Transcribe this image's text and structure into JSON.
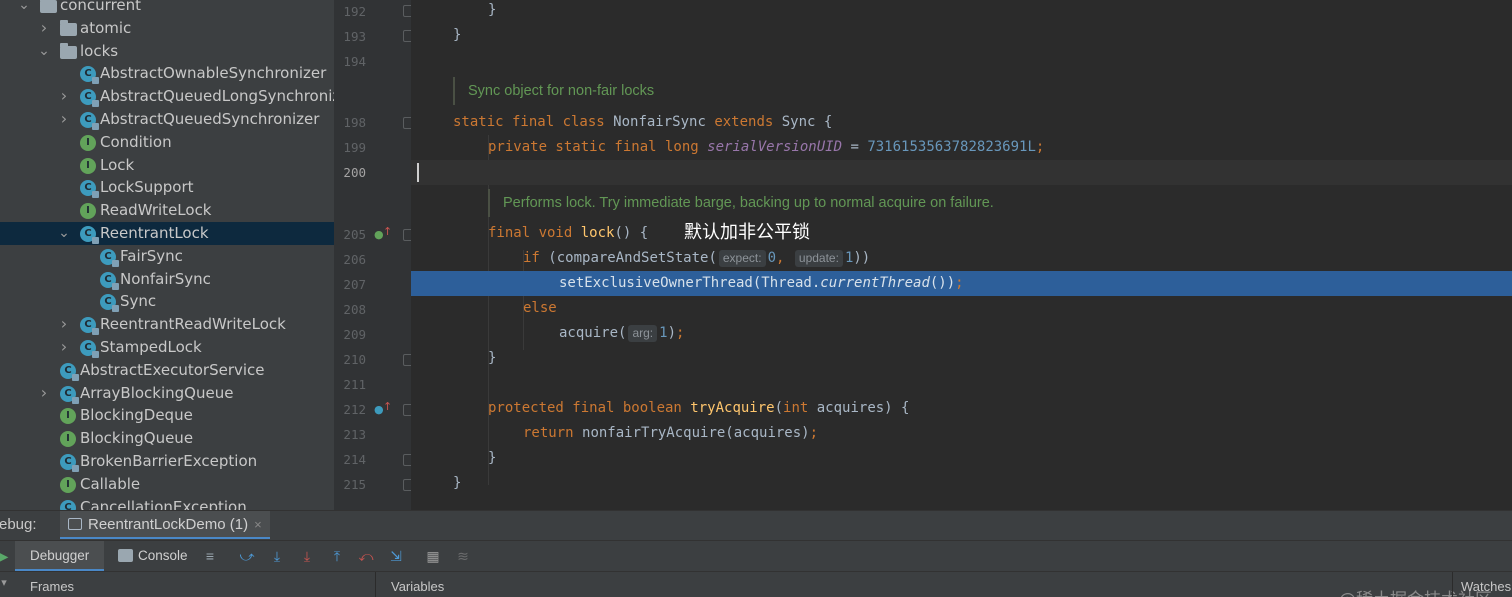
{
  "project_tree": {
    "items": [
      {
        "label": "concurrent",
        "kind": "package",
        "expand": "expanded"
      },
      {
        "label": "atomic",
        "kind": "package",
        "expand": "collapsed"
      },
      {
        "label": "locks",
        "kind": "package",
        "expand": "expanded"
      },
      {
        "label": "AbstractOwnableSynchronizer",
        "kind": "class",
        "expand": "none"
      },
      {
        "label": "AbstractQueuedLongSynchronizer",
        "kind": "class",
        "expand": "collapsed"
      },
      {
        "label": "AbstractQueuedSynchronizer",
        "kind": "class",
        "expand": "collapsed"
      },
      {
        "label": "Condition",
        "kind": "interface",
        "expand": "none"
      },
      {
        "label": "Lock",
        "kind": "interface",
        "expand": "none"
      },
      {
        "label": "LockSupport",
        "kind": "class",
        "expand": "none"
      },
      {
        "label": "ReadWriteLock",
        "kind": "interface",
        "expand": "none"
      },
      {
        "label": "ReentrantLock",
        "kind": "class",
        "expand": "expanded",
        "selected": true
      },
      {
        "label": "FairSync",
        "kind": "class",
        "expand": "none"
      },
      {
        "label": "NonfairSync",
        "kind": "class",
        "expand": "none"
      },
      {
        "label": "Sync",
        "kind": "class",
        "expand": "none"
      },
      {
        "label": "ReentrantReadWriteLock",
        "kind": "class",
        "expand": "collapsed"
      },
      {
        "label": "StampedLock",
        "kind": "class",
        "expand": "collapsed"
      },
      {
        "label": "AbstractExecutorService",
        "kind": "class",
        "expand": "none"
      },
      {
        "label": "ArrayBlockingQueue",
        "kind": "class",
        "expand": "collapsed"
      },
      {
        "label": "BlockingDeque",
        "kind": "interface",
        "expand": "none"
      },
      {
        "label": "BlockingQueue",
        "kind": "interface",
        "expand": "none"
      },
      {
        "label": "BrokenBarrierException",
        "kind": "class",
        "expand": "none"
      },
      {
        "label": "Callable",
        "kind": "interface",
        "expand": "none"
      },
      {
        "label": "CancellationException",
        "kind": "class",
        "expand": "none"
      }
    ]
  },
  "gutter": {
    "line_numbers": [
      "192",
      "193",
      "194",
      "198",
      "199",
      "200",
      "205",
      "206",
      "207",
      "208",
      "209",
      "210",
      "211",
      "212",
      "213",
      "214",
      "215"
    ]
  },
  "editor": {
    "doc_comment_1": "Sync object for non-fair locks",
    "doc_comment_2": "Performs lock. Try immediate barge, backing up to normal acquire on failure.",
    "code": {
      "l192": "}",
      "l193": "}",
      "l198_kw": "static final class ",
      "l198_name": "NonfairSync ",
      "l198_ext": "extends ",
      "l198_rest": "Sync {",
      "l199_kw": "private static final long ",
      "l199_field": "serialVersionUID",
      "l199_eq": " = ",
      "l199_num": "7316153563782823691L",
      "l199_semi": ";",
      "l205_kw": "final void ",
      "l205_fn": "lock",
      "l205_rest": "() {",
      "l206_kw": "if ",
      "l206_a": "(compareAndSetState(",
      "l206_hint1": "expect:",
      "l206_n1": "0",
      "l206_comma": ",",
      "l206_hint2": "update:",
      "l206_n2": "1",
      "l206_end": "))",
      "l207_a": "setExclusiveOwnerThread(Thread.",
      "l207_b": "currentThread",
      "l207_c": "())",
      "l207_semi": ";",
      "l208": "else",
      "l209_a": "acquire(",
      "l209_hint": "arg:",
      "l209_n": "1",
      "l209_end": ")",
      "l209_semi": ";",
      "l210": "}",
      "l212_kw": "protected final boolean ",
      "l212_fn": "tryAcquire",
      "l212_p": "(",
      "l212_int": "int ",
      "l212_rest": "acquires) {",
      "l213_kw": "return ",
      "l213_rest": "nonfairTryAcquire(acquires)",
      "l213_semi": ";",
      "l214": "}",
      "l215": "}"
    },
    "overlay_annotation": "默认加非公平锁"
  },
  "debug_panel": {
    "title": "ebug:",
    "session_tab": "ReentrantLockDemo (1)",
    "close_glyph": "×",
    "tabs": {
      "debugger": "Debugger",
      "console": "Console"
    },
    "panels": {
      "frames": "Frames",
      "variables": "Variables",
      "watches": "Watches"
    },
    "watermark": "@稀土掘金技术社区"
  },
  "colors": {
    "tree_bg": "#3c3f41",
    "editor_bg": "#2b2b2b",
    "selection": "#2d5f9a",
    "keyword": "#cc7832",
    "method": "#ffc66d",
    "number": "#6897bb",
    "doc_comment": "#629755"
  }
}
